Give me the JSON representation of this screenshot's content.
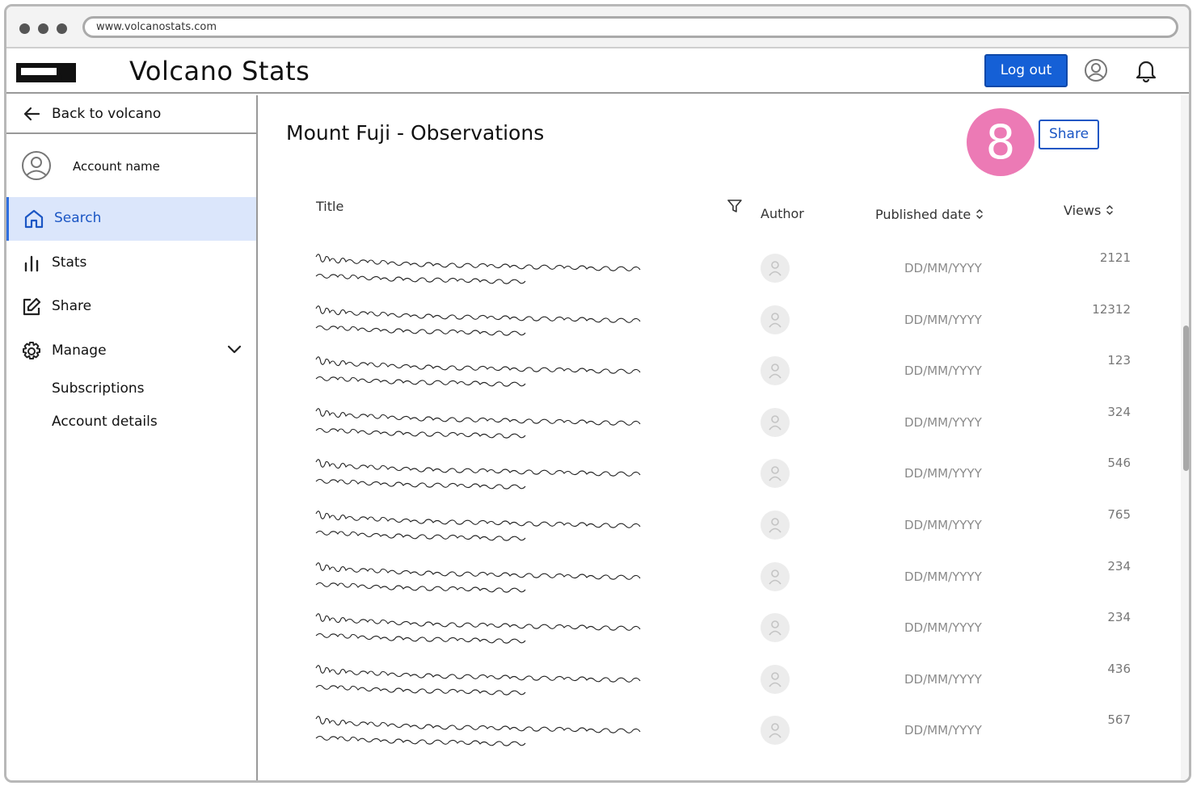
{
  "browser": {
    "url": "www.volcanostats.com"
  },
  "header": {
    "app_title": "Volcano Stats",
    "logout_label": "Log out"
  },
  "sidebar": {
    "back_label": "Back to volcano",
    "account_name": "Account name",
    "nav": [
      {
        "label": "Search",
        "icon": "home-icon",
        "active": true
      },
      {
        "label": "Stats",
        "icon": "bar-chart-icon",
        "active": false
      },
      {
        "label": "Share",
        "icon": "edit-icon",
        "active": false
      },
      {
        "label": "Manage",
        "icon": "gear-icon",
        "active": false
      }
    ],
    "sub_items": [
      "Subscriptions",
      "Account details"
    ]
  },
  "main": {
    "page_title": "Mount Fuji - Observations",
    "badge_number": "8",
    "share_label": "Share",
    "columns": {
      "title": "Title",
      "author": "Author",
      "published": "Published date",
      "views": "Views"
    },
    "rows": [
      {
        "date": "DD/MM/YYYY",
        "views": "2121"
      },
      {
        "date": "DD/MM/YYYY",
        "views": "12312"
      },
      {
        "date": "DD/MM/YYYY",
        "views": "123"
      },
      {
        "date": "DD/MM/YYYY",
        "views": "324"
      },
      {
        "date": "DD/MM/YYYY",
        "views": "546"
      },
      {
        "date": "DD/MM/YYYY",
        "views": "765"
      },
      {
        "date": "DD/MM/YYYY",
        "views": "234"
      },
      {
        "date": "DD/MM/YYYY",
        "views": "234"
      },
      {
        "date": "DD/MM/YYYY",
        "views": "436"
      },
      {
        "date": "DD/MM/YYYY",
        "views": "567"
      }
    ]
  },
  "colors": {
    "accent": "#1560d6",
    "badge": "#ec7ab5",
    "active_bg": "#dbe6fb"
  }
}
